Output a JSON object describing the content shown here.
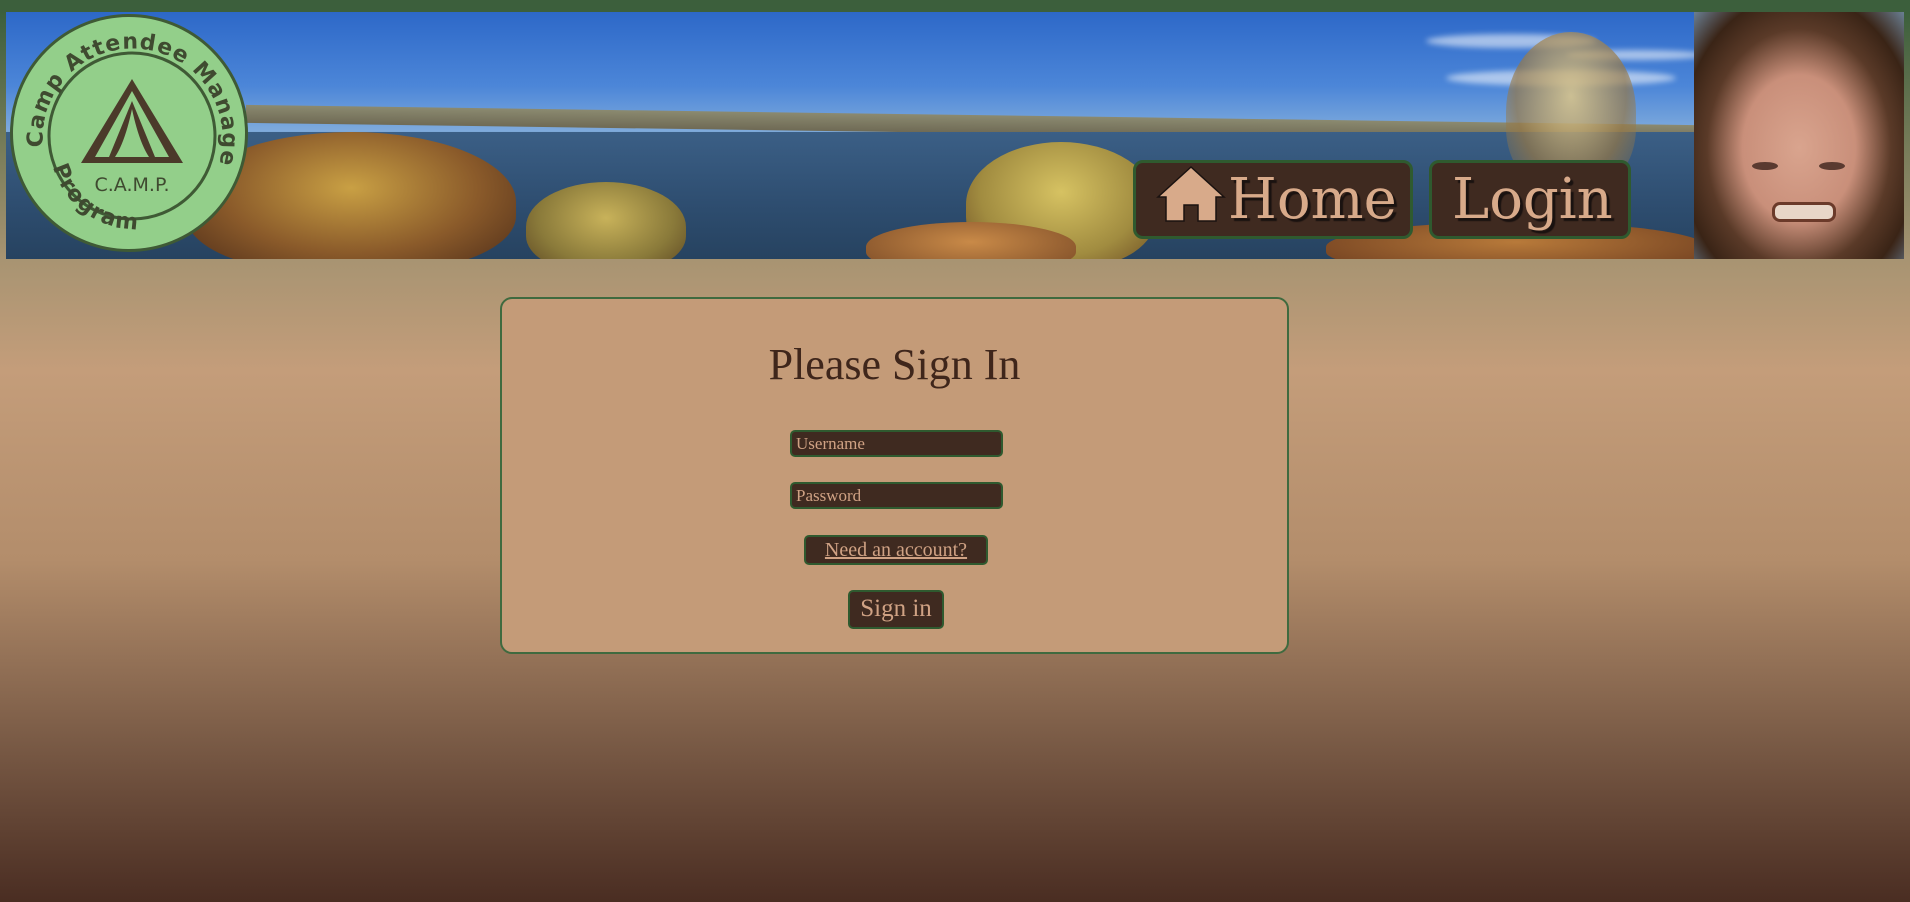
{
  "header": {
    "logo": {
      "ring_text_top": "Camp Attendee Management",
      "ring_text_bottom": "Program",
      "center_text": "C.A.M.P."
    },
    "nav": {
      "home_label": "Home",
      "login_label": "Login",
      "home_icon": "home-icon"
    }
  },
  "signin": {
    "title": "Please Sign In",
    "username_placeholder": "Username",
    "password_placeholder": "Password",
    "account_link": "Need an account?",
    "submit_label": "Sign in"
  },
  "colors": {
    "header_bar": "#3c5f3c",
    "button_bg": "#3f2a20",
    "button_border": "#2f5a2f",
    "button_text": "#d0a284",
    "card_bg": "#c49b78",
    "title_text": "#3f261b",
    "logo_green": "#93cf8a"
  }
}
